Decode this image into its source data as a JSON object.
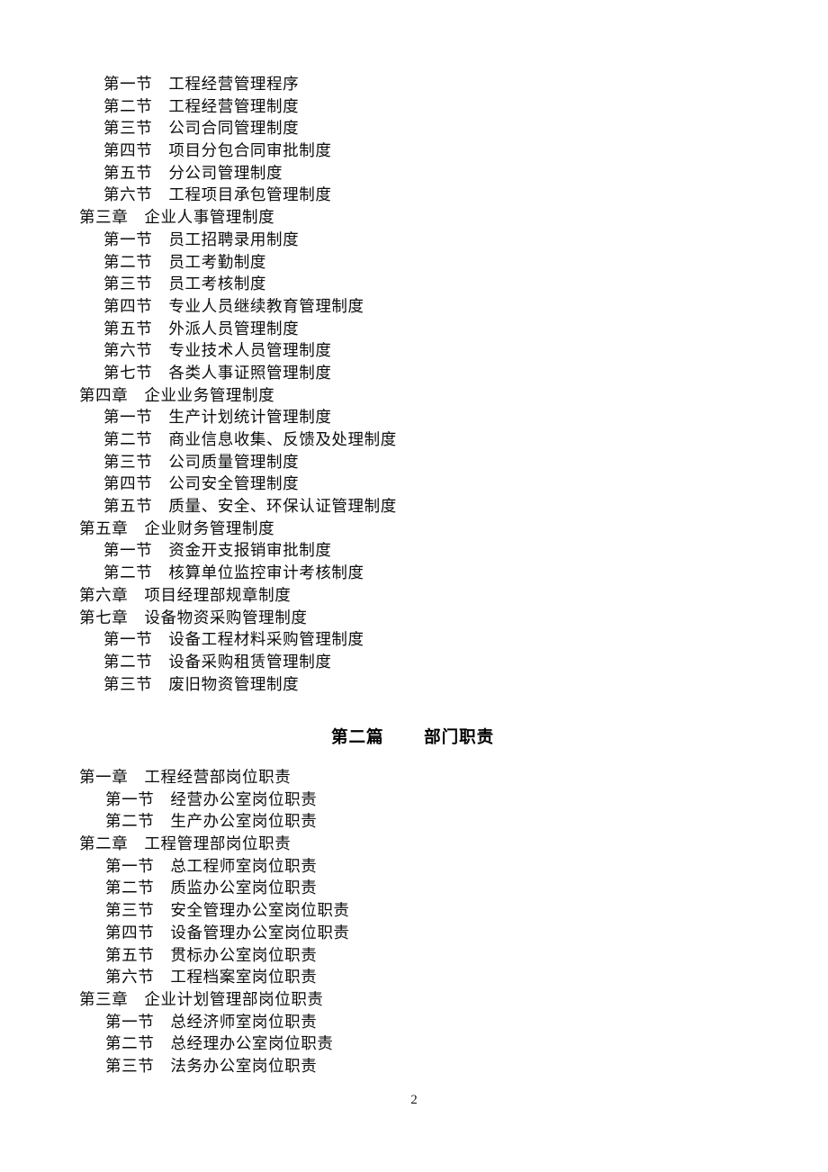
{
  "document": {
    "page_number": "2",
    "text_color": "#0d0d0d"
  },
  "toc_block_one": {
    "lines": [
      {
        "level": "section",
        "label": "第一节",
        "title": "工程经营管理程序"
      },
      {
        "level": "section",
        "label": "第二节",
        "title": "工程经营管理制度"
      },
      {
        "level": "section",
        "label": "第三节",
        "title": "公司合同管理制度"
      },
      {
        "level": "section",
        "label": "第四节",
        "title": "项目分包合同审批制度"
      },
      {
        "level": "section",
        "label": "第五节",
        "title": "分公司管理制度"
      },
      {
        "level": "section",
        "label": "第六节",
        "title": "工程项目承包管理制度"
      },
      {
        "level": "chapter",
        "label": "第三章",
        "title": "企业人事管理制度"
      },
      {
        "level": "section",
        "label": "第一节",
        "title": "员工招聘录用制度"
      },
      {
        "level": "section",
        "label": "第二节",
        "title": "员工考勤制度"
      },
      {
        "level": "section",
        "label": "第三节",
        "title": "员工考核制度"
      },
      {
        "level": "section",
        "label": "第四节",
        "title": "专业人员继续教育管理制度"
      },
      {
        "level": "section",
        "label": "第五节",
        "title": "外派人员管理制度"
      },
      {
        "level": "section",
        "label": "第六节",
        "title": "专业技术人员管理制度"
      },
      {
        "level": "section",
        "label": "第七节",
        "title": "各类人事证照管理制度"
      },
      {
        "level": "chapter",
        "label": "第四章",
        "title": "企业业务管理制度"
      },
      {
        "level": "section",
        "label": "第一节",
        "title": "生产计划统计管理制度"
      },
      {
        "level": "section",
        "label": "第二节",
        "title": "商业信息收集、反馈及处理制度"
      },
      {
        "level": "section",
        "label": "第三节",
        "title": "公司质量管理制度"
      },
      {
        "level": "section",
        "label": "第四节",
        "title": "公司安全管理制度"
      },
      {
        "level": "section",
        "label": "第五节",
        "title": "质量、安全、环保认证管理制度"
      },
      {
        "level": "chapter",
        "label": "第五章",
        "title": "企业财务管理制度"
      },
      {
        "level": "section",
        "label": "第一节",
        "title": "资金开支报销审批制度"
      },
      {
        "level": "section",
        "label": "第二节",
        "title": "核算单位监控审计考核制度"
      },
      {
        "level": "chapter",
        "label": "第六章",
        "title": "项目经理部规章制度"
      },
      {
        "level": "chapter",
        "label": "第七章",
        "title": "设备物资采购管理制度"
      },
      {
        "level": "section",
        "label": "第一节",
        "title": "设备工程材料采购管理制度"
      },
      {
        "level": "section",
        "label": "第二节",
        "title": "设备采购租赁管理制度"
      },
      {
        "level": "section",
        "label": "第三节",
        "title": "废旧物资管理制度"
      }
    ]
  },
  "part_heading": {
    "text": "第二篇      部门职责"
  },
  "toc_block_two": {
    "lines": [
      {
        "level": "chapter",
        "label": "第一章",
        "title": "工程经营部岗位职责"
      },
      {
        "level": "section",
        "label": "第一节",
        "title": "经营办公室岗位职责"
      },
      {
        "level": "section",
        "label": "第二节",
        "title": "生产办公室岗位职责"
      },
      {
        "level": "chapter",
        "label": "第二章",
        "title": "工程管理部岗位职责"
      },
      {
        "level": "section",
        "label": "第一节",
        "title": "总工程师室岗位职责"
      },
      {
        "level": "section",
        "label": "第二节",
        "title": "质监办公室岗位职责"
      },
      {
        "level": "section",
        "label": "第三节",
        "title": "安全管理办公室岗位职责"
      },
      {
        "level": "section",
        "label": "第四节",
        "title": "设备管理办公室岗位职责"
      },
      {
        "level": "section",
        "label": "第五节",
        "title": "贯标办公室岗位职责"
      },
      {
        "level": "section",
        "label": "第六节",
        "title": "工程档案室岗位职责"
      },
      {
        "level": "chapter",
        "label": "第三章",
        "title": "企业计划管理部岗位职责"
      },
      {
        "level": "section",
        "label": "第一节",
        "title": "总经济师室岗位职责"
      },
      {
        "level": "section",
        "label": "第二节",
        "title": "总经理办公室岗位职责"
      },
      {
        "level": "section",
        "label": "第三节",
        "title": "法务办公室岗位职责"
      }
    ]
  }
}
